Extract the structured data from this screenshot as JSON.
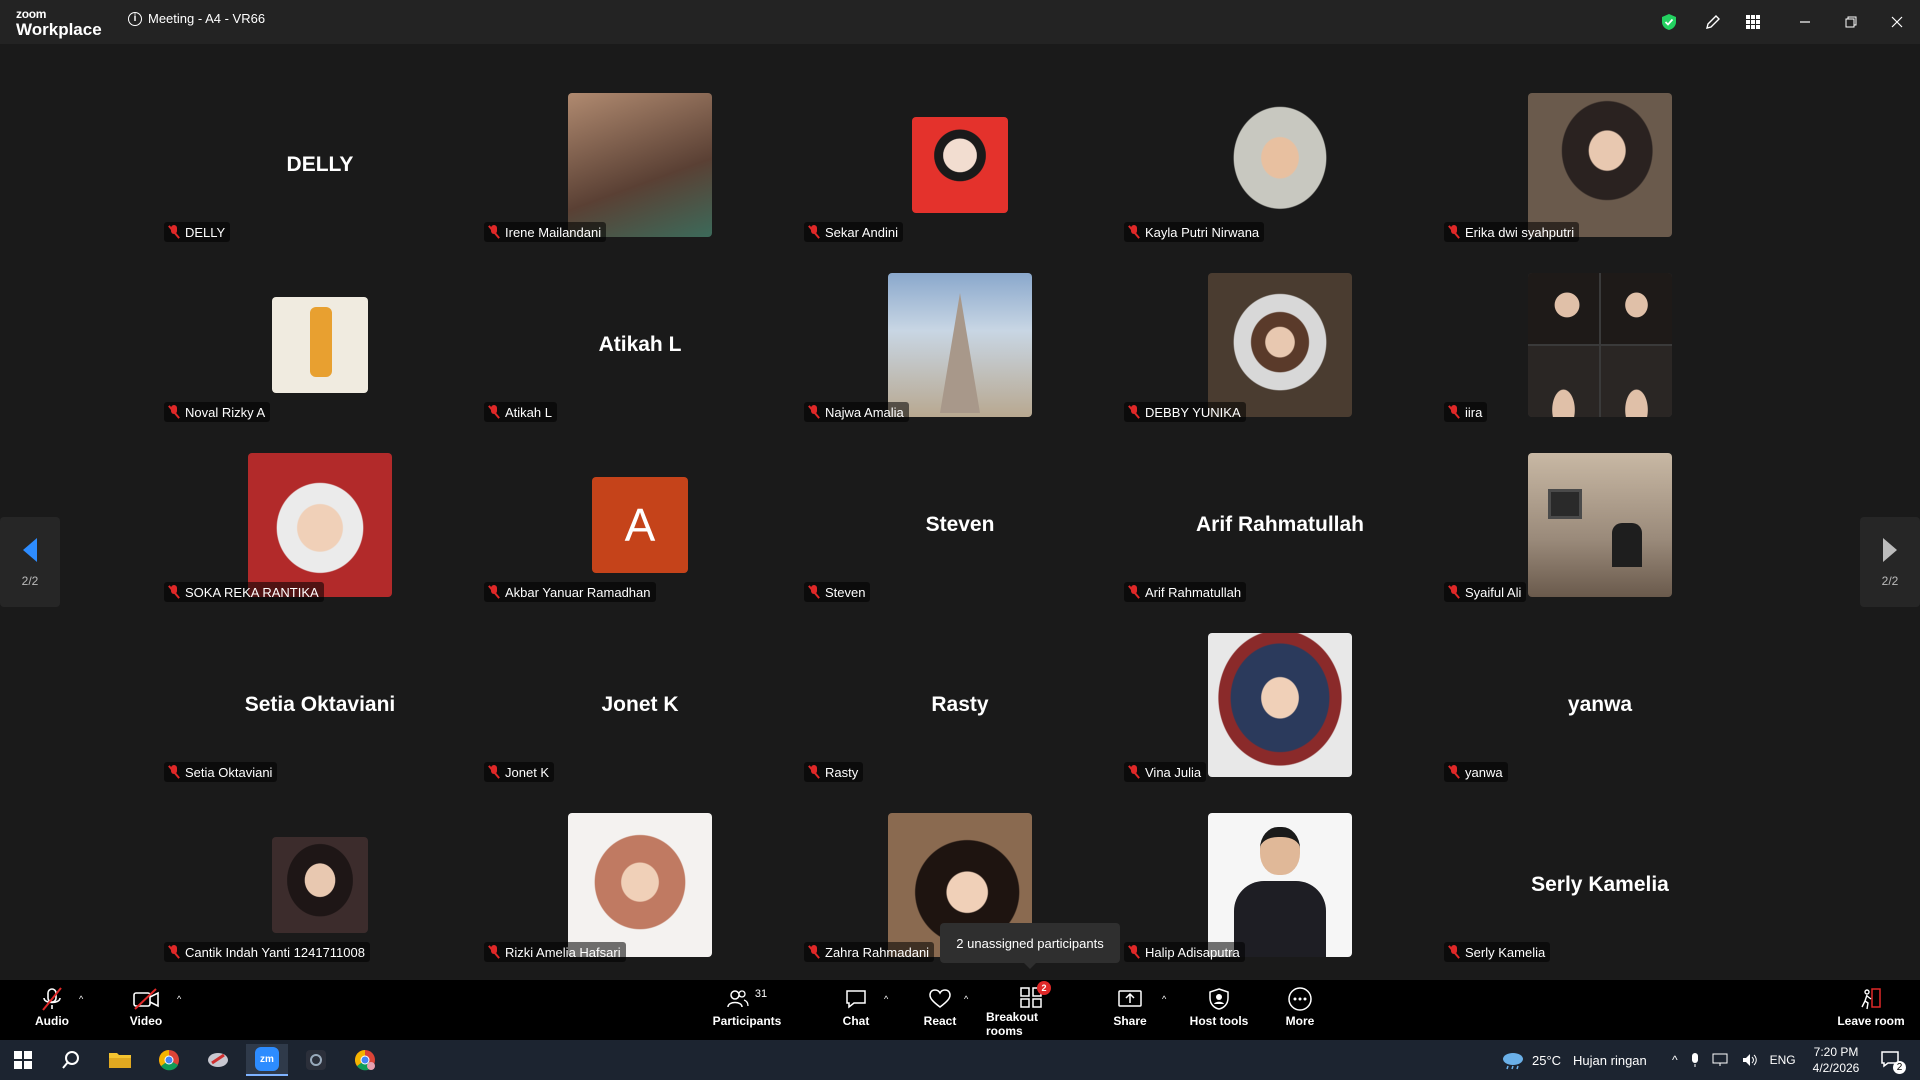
{
  "titlebar": {
    "logo_top": "zoom",
    "logo_bottom": "Workplace",
    "meeting_title": "Meeting - A4 - VR66",
    "icons": [
      "shield-check-icon",
      "pencil-icon",
      "apps-grid-icon",
      "minimize-icon",
      "restore-icon",
      "close-icon"
    ]
  },
  "gallery": {
    "page_left": "2/2",
    "page_right": "2/2",
    "participants": [
      {
        "name": "DELLY",
        "display": "name",
        "bigname": "DELLY"
      },
      {
        "name": "Irene Mailandani",
        "display": "photo",
        "color": "#8a6a58"
      },
      {
        "name": "Sekar Andini",
        "display": "photo-small",
        "color": "#e4322c"
      },
      {
        "name": "Kayla Putri Nirwana",
        "display": "photo",
        "color": "#2a2a2a"
      },
      {
        "name": "Erika dwi syahputri",
        "display": "photo",
        "color": "#4a3c34"
      },
      {
        "name": "Noval Rizky A",
        "display": "photo-small",
        "color": "#e8e2d4"
      },
      {
        "name": "Atikah L",
        "display": "name",
        "bigname": "Atikah L"
      },
      {
        "name": "Najwa Amalia",
        "display": "photo",
        "color": "#9bb3cc"
      },
      {
        "name": "DEBBY YUNIKA",
        "display": "photo",
        "color": "#6a5a4c"
      },
      {
        "name": "iira",
        "display": "photo",
        "color": "#3a3a3a"
      },
      {
        "name": "SOKA REKA RANTIKA",
        "display": "photo",
        "color": "#b22a2a"
      },
      {
        "name": "Akbar Yanuar Ramadhan",
        "display": "avatar",
        "initial": "A",
        "color": "#c5431a"
      },
      {
        "name": "Steven",
        "display": "name",
        "bigname": "Steven"
      },
      {
        "name": "Arif Rahmatullah",
        "display": "name",
        "bigname": "Arif Rahmatullah"
      },
      {
        "name": "Syaiful Ali",
        "display": "photo",
        "color": "#9a8a7a"
      },
      {
        "name": "Setia Oktaviani",
        "display": "name",
        "bigname": "Setia Oktaviani"
      },
      {
        "name": "Jonet K",
        "display": "name",
        "bigname": "Jonet K"
      },
      {
        "name": "Rasty",
        "display": "name",
        "bigname": "Rasty"
      },
      {
        "name": "Vina Julia",
        "display": "photo",
        "color": "#2b3a5c"
      },
      {
        "name": "yanwa",
        "display": "name",
        "bigname": "yanwa"
      },
      {
        "name": "Cantik Indah Yanti 1241711008",
        "display": "photo-small",
        "color": "#3c2c2c"
      },
      {
        "name": "Rizki Amelia Hafsari",
        "display": "photo",
        "color": "#f0eeec"
      },
      {
        "name": "Zahra Rahmadani",
        "display": "photo",
        "color": "#5c4a3c"
      },
      {
        "name": "Halip Adisaputra",
        "display": "photo",
        "color": "#f4f4f4"
      },
      {
        "name": "Serly Kamelia",
        "display": "name",
        "bigname": "Serly Kamelia"
      }
    ]
  },
  "tooltip": "2 unassigned participants",
  "toolbar": {
    "audio": "Audio",
    "video": "Video",
    "participants": "Participants",
    "participants_count": "31",
    "chat": "Chat",
    "react": "React",
    "breakout": "Breakout rooms",
    "breakout_badge": "2",
    "share": "Share",
    "host_tools": "Host tools",
    "more": "More",
    "leave": "Leave room"
  },
  "taskbar": {
    "weather_temp": "25°C",
    "weather_desc": "Hujan ringan",
    "lang": "ENG",
    "time": "7:20 PM",
    "date": "4/2/2026",
    "notif_count": "2"
  },
  "colors": {
    "accent_blue": "#2d8cff",
    "mic_off_red": "#e02828",
    "shield_green": "#23d160"
  }
}
